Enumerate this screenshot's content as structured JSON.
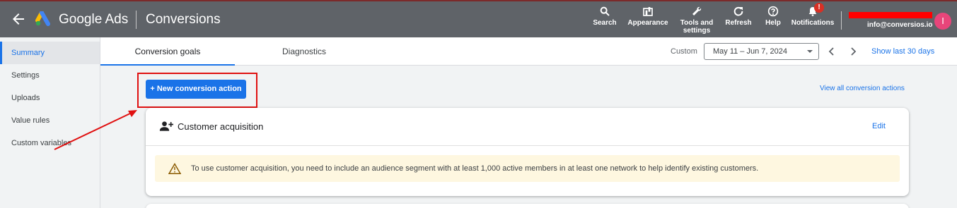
{
  "topbar": {
    "brand": "Google Ads",
    "title": "Conversions",
    "tools": [
      {
        "label": "Search",
        "icon": "search-icon"
      },
      {
        "label": "Appearance",
        "icon": "appearance-icon"
      },
      {
        "label_line1": "Tools and",
        "label_line2": "settings",
        "icon": "wrench-icon"
      },
      {
        "label": "Refresh",
        "icon": "refresh-icon"
      },
      {
        "label": "Help",
        "icon": "help-icon"
      },
      {
        "label": "Notifications",
        "icon": "bell-icon",
        "badge": "!"
      }
    ],
    "email": "info@conversios.io",
    "avatar_letter": "I"
  },
  "sidebar": {
    "items": [
      {
        "label": "Summary",
        "active": true
      },
      {
        "label": "Settings"
      },
      {
        "label": "Uploads"
      },
      {
        "label": "Value rules"
      },
      {
        "label": "Custom variables"
      }
    ]
  },
  "tabs": {
    "items": [
      {
        "label": "Conversion goals",
        "active": true
      },
      {
        "label": "Diagnostics"
      }
    ],
    "custom_label": "Custom",
    "date_range": "May 11 – Jun 7, 2024",
    "show_last": "Show last 30 days"
  },
  "main": {
    "new_button": "+ New conversion action",
    "view_all": "View all conversion actions",
    "card": {
      "title": "Customer acquisition",
      "edit": "Edit",
      "warning": "To use customer acquisition, you need to include an audience segment with at least 1,000 active members in at least one network to help identify existing customers."
    }
  },
  "colors": {
    "topbar": "#5f6368",
    "accent": "#1a73e8",
    "highlight": "#e01010",
    "warning_bg": "#fef7e0"
  }
}
